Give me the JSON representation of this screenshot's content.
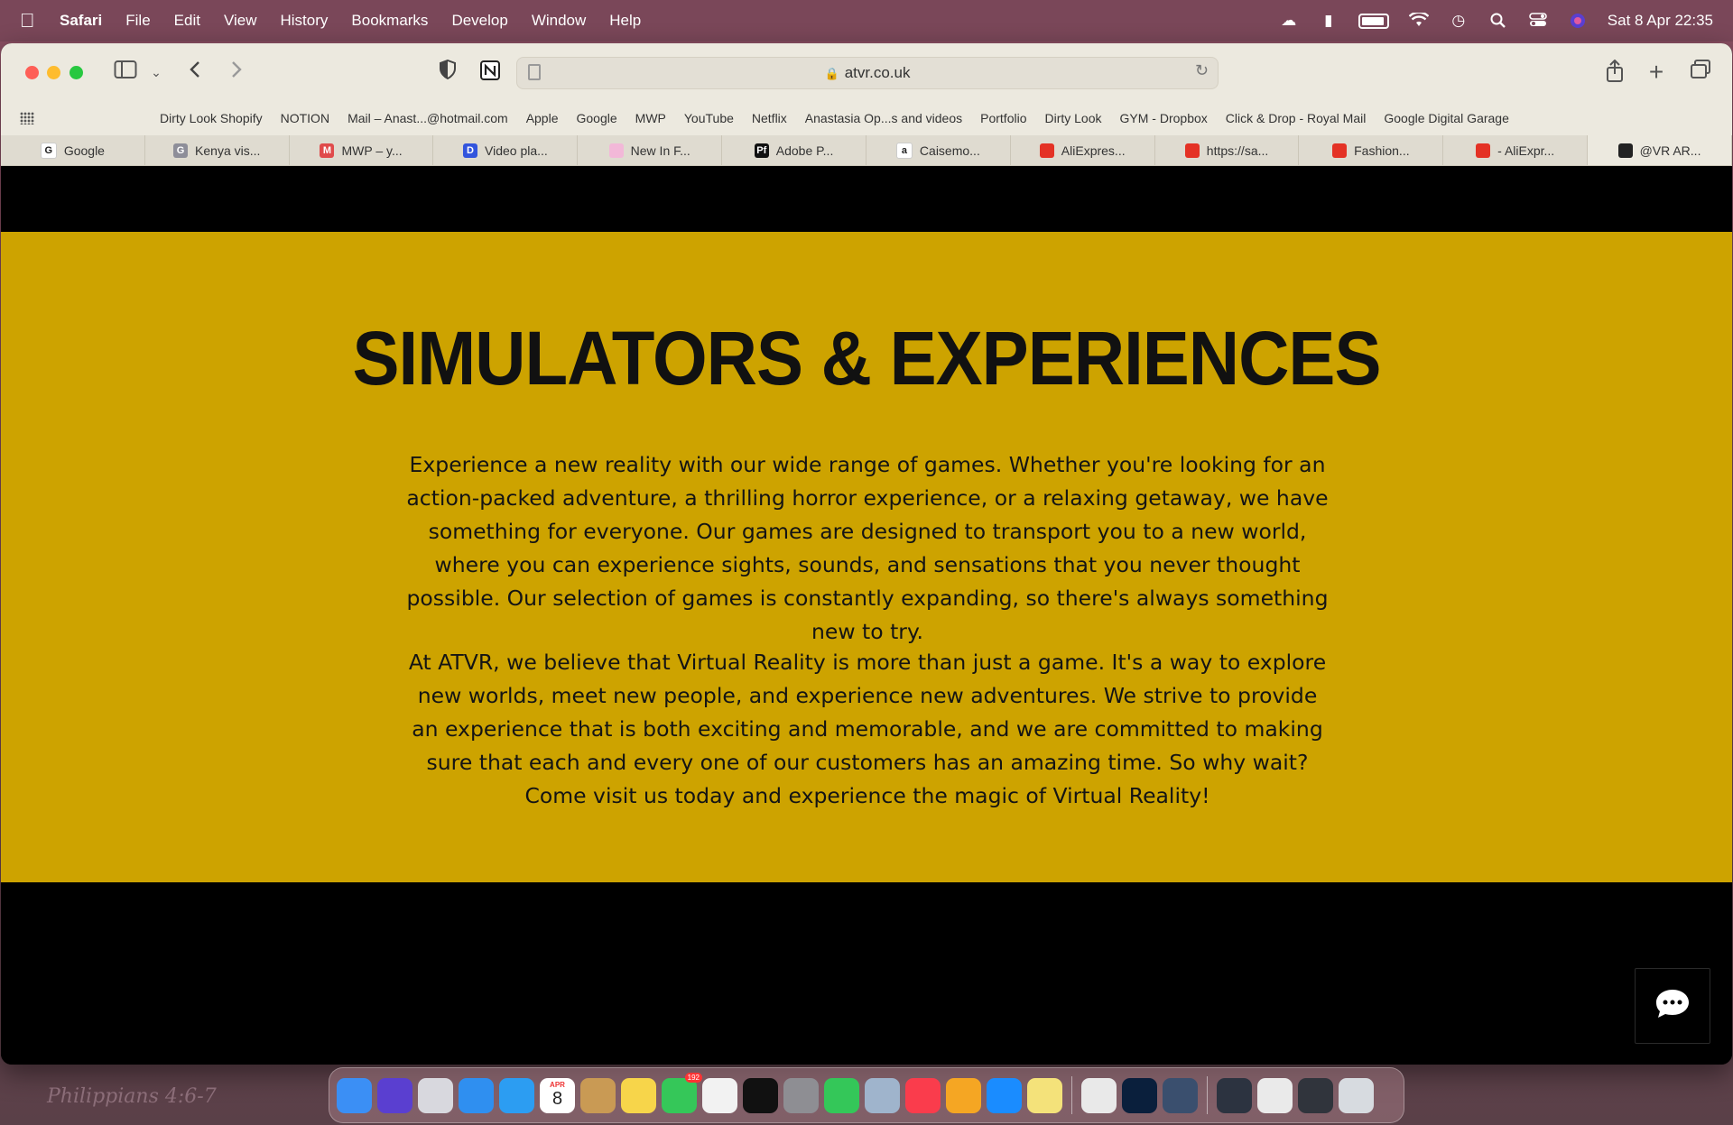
{
  "menubar": {
    "app_name": "Safari",
    "items": [
      "File",
      "Edit",
      "View",
      "History",
      "Bookmarks",
      "Develop",
      "Window",
      "Help"
    ],
    "datetime": "Sat 8 Apr  22:35"
  },
  "toolbar": {
    "url": "atvr.co.uk"
  },
  "favorites": [
    "Dirty Look Shopify",
    "NOTION",
    "Mail – Anast...@hotmail.com",
    "Apple",
    "Google",
    "MWP",
    "YouTube",
    "Netflix",
    "Anastasia Op...s and videos",
    "Portfolio",
    "Dirty Look",
    "GYM - Dropbox",
    "Click & Drop - Royal Mail",
    "Google Digital Garage"
  ],
  "tabs": [
    {
      "label": "Google",
      "color": "#ffffff",
      "glyph": "G"
    },
    {
      "label": "Kenya vis...",
      "color": "#8e8e99",
      "glyph": "G"
    },
    {
      "label": "MWP – y...",
      "color": "#e04b4b",
      "glyph": "M"
    },
    {
      "label": "Video pla...",
      "color": "#3355dd",
      "glyph": "D"
    },
    {
      "label": "New In F...",
      "color": "#f2b8d8",
      "glyph": ""
    },
    {
      "label": "Adobe P...",
      "color": "#111111",
      "glyph": "Pf"
    },
    {
      "label": "Caisemo...",
      "color": "#ffffff",
      "glyph": "a"
    },
    {
      "label": "AliExpres...",
      "color": "#e43225",
      "glyph": ""
    },
    {
      "label": "https://sa...",
      "color": "#e43225",
      "glyph": ""
    },
    {
      "label": "Fashion...",
      "color": "#e43225",
      "glyph": ""
    },
    {
      "label": "- AliExpr...",
      "color": "#e43225",
      "glyph": ""
    },
    {
      "label": "@VR AR...",
      "color": "#222222",
      "glyph": ""
    }
  ],
  "page": {
    "headline": "SIMULATORS & EXPERIENCES",
    "paragraph1": "Experience a new reality with our wide range of games. Whether you're looking for an action-packed adventure, a thrilling horror experience, or a relaxing getaway, we have something for everyone. Our games are designed to transport you to a new world, where you can experience sights, sounds, and sensations that you never thought possible. Our selection of games is constantly expanding, so there's always something new to try.",
    "paragraph2": "At ATVR, we believe that Virtual Reality is more than just a game. It's a way to explore new worlds, meet new people, and experience new adventures. We strive to provide an experience that is both exciting and memorable, and we are committed to making sure that each and every one of our customers has an amazing time. So why wait? Come visit us today and experience the magic of Virtual Reality!"
  },
  "desktop": {
    "note": "Philippians 4:6-7"
  },
  "dock": {
    "calendar_month": "APR",
    "calendar_day": "8",
    "messages_badge": "192",
    "apps": [
      {
        "name": "finder-icon",
        "color": "#3b8ff5"
      },
      {
        "name": "siri-icon",
        "color": "#5a3fd0"
      },
      {
        "name": "launchpad-icon",
        "color": "#d8d8de"
      },
      {
        "name": "mail-icon",
        "color": "#2f8ff0"
      },
      {
        "name": "safari-icon",
        "color": "#2c9df2"
      },
      {
        "name": "calendar-icon",
        "color": "#ffffff"
      },
      {
        "name": "contacts-icon",
        "color": "#c99a54"
      },
      {
        "name": "notes-icon",
        "color": "#f7d54a"
      },
      {
        "name": "messages-icon",
        "color": "#35c759"
      },
      {
        "name": "reminders-icon",
        "color": "#f2f2f2"
      },
      {
        "name": "tidal-icon",
        "color": "#111111"
      },
      {
        "name": "system-settings-icon",
        "color": "#8e8e93"
      },
      {
        "name": "facetime-icon",
        "color": "#34c759"
      },
      {
        "name": "preview-icon",
        "color": "#9fb4cc"
      },
      {
        "name": "music-icon",
        "color": "#fa3c4c"
      },
      {
        "name": "photos-icon",
        "color": "#f5a623"
      },
      {
        "name": "app-store-icon",
        "color": "#1a8cff"
      },
      {
        "name": "stickies-icon",
        "color": "#f4e27a"
      },
      {
        "name": "chrome-icon",
        "color": "#e9e9e9"
      },
      {
        "name": "photoshop-icon",
        "color": "#0a1f3c"
      },
      {
        "name": "quicktime-icon",
        "color": "#3a4f6e"
      },
      {
        "name": "window-thumb-1-icon",
        "color": "#2c3340"
      },
      {
        "name": "window-thumb-2-icon",
        "color": "#eaeaea"
      },
      {
        "name": "window-thumb-3-icon",
        "color": "#30343c"
      },
      {
        "name": "trash-icon",
        "color": "#d7dbe0"
      }
    ]
  }
}
